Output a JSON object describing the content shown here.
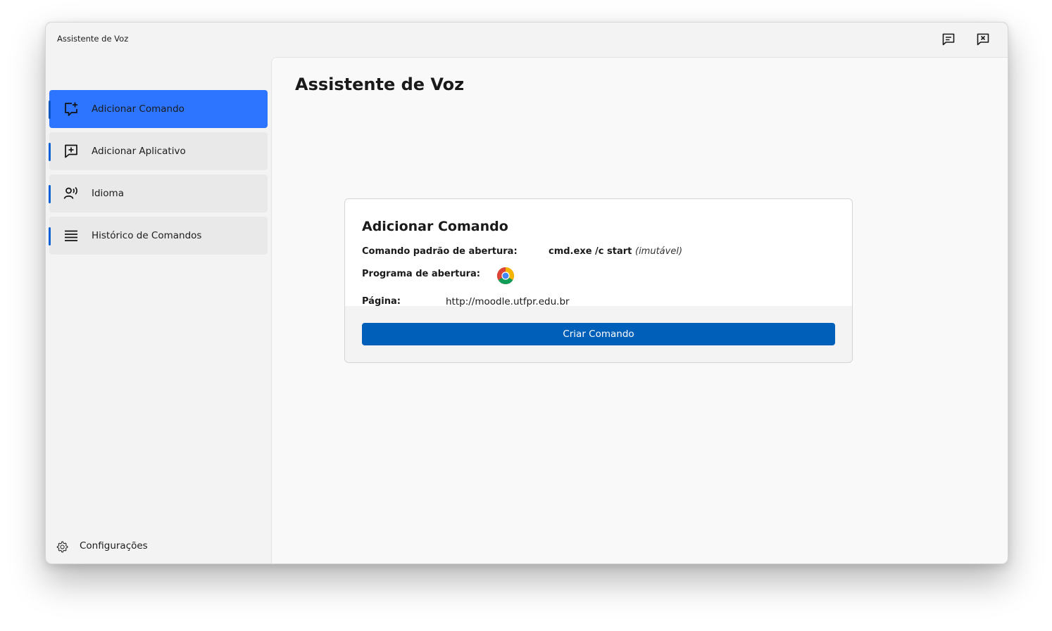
{
  "window": {
    "title": "Assistente de Voz",
    "controls": {
      "feedback_icon": "feedback-icon",
      "close_icon": "close-window-icon"
    }
  },
  "sidebar": {
    "items": [
      {
        "label": "Adicionar Comando",
        "icon": "add-comment-icon",
        "active": true
      },
      {
        "label": "Adicionar Aplicativo",
        "icon": "add-box-icon",
        "active": false
      },
      {
        "label": "Idioma",
        "icon": "voice-person-icon",
        "active": false
      },
      {
        "label": "Histórico de Comandos",
        "icon": "list-icon",
        "active": false
      }
    ],
    "settings": {
      "label": "Configurações",
      "icon": "gear-icon"
    }
  },
  "main": {
    "title": "Assistente de Voz",
    "card": {
      "title": "Adicionar Comando",
      "default_command_label": "Comando padrão de abertura:",
      "default_command_value": "cmd.exe /c start",
      "default_command_note": "(imutável)",
      "program_label": "Programa de abertura:",
      "program_icon": "chrome-icon",
      "page_label": "Página:",
      "page_value": "http://moodle.utfpr.edu.br",
      "create_button": "Criar Comando"
    }
  },
  "colors": {
    "accent": "#2d74ff",
    "button": "#005fb8",
    "indicator": "#1062d4"
  }
}
